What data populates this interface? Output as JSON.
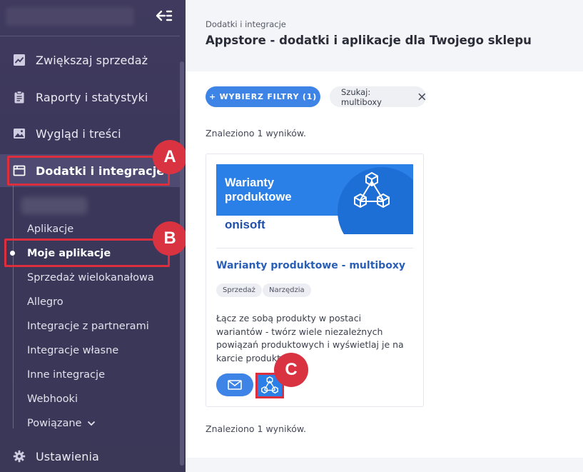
{
  "sidebar": {
    "nav": [
      {
        "label": "Zwiększaj sprzedaż",
        "icon": "chart-line-icon"
      },
      {
        "label": "Raporty i statystyki",
        "icon": "clipboard-icon"
      },
      {
        "label": "Wygląd i treści",
        "icon": "image-icon"
      },
      {
        "label": "Dodatki i integracje",
        "icon": "window-icon"
      }
    ],
    "sub_items": [
      "Aplikacje",
      "Moje aplikacje",
      "Sprzedaż wielokanałowa",
      "Allegro",
      "Integracje z partnerami",
      "Integracje własne",
      "Inne integracje",
      "Webhooki",
      "Powiązane"
    ],
    "settings_label": "Ustawienia"
  },
  "markers": {
    "a": "A",
    "b": "B",
    "c": "C"
  },
  "header": {
    "breadcrumb": "Dodatki i integracje",
    "title": "Appstore - dodatki i aplikacje dla Twojego sklepu"
  },
  "filters": {
    "button_label": "+ WYBIERZ FILTRY (1)",
    "search_chip": "Szukaj: multiboxy"
  },
  "results_text": "Znaleziono 1 wyników.",
  "app_card": {
    "banner_line1": "Warianty",
    "banner_line2": "produktowe",
    "banner_logo": "onisoft",
    "title": "Warianty produktowe - multiboxy",
    "tags": [
      "Sprzedaż",
      "Narzędzia"
    ],
    "description": "Łącz ze sobą produkty w postaci wariantów - twórz wiele niezależnych powiązań produktowych i wyświetlaj je na karcie produktu."
  },
  "colors": {
    "sidebar_bg": "#3d395c",
    "accent": "#3d84e6",
    "highlight": "#dd2e3d"
  }
}
